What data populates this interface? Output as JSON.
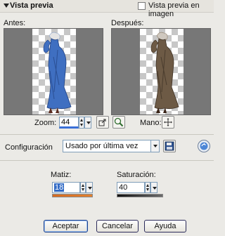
{
  "header": {
    "title": "Vista previa",
    "image_preview_label": "Vista previa en imagen",
    "image_preview_checked": false
  },
  "preview": {
    "before_label": "Antes:",
    "after_label": "Después:"
  },
  "zoom": {
    "label": "Zoom:",
    "value": "44",
    "hand_label": "Mano:"
  },
  "config": {
    "label": "Configuración",
    "selected": "Usado por última vez"
  },
  "hue": {
    "label": "Matiz:",
    "value": "18"
  },
  "saturation": {
    "label": "Saturación:",
    "value": "40"
  },
  "buttons": {
    "accept": "Aceptar",
    "cancel": "Cancelar",
    "help": "Ayuda"
  },
  "colors": {
    "before_dress": "#3f6fc1",
    "after_dress": "#6d5a45",
    "hue_strip": "#d76a1f",
    "selection": "#316ac5"
  }
}
